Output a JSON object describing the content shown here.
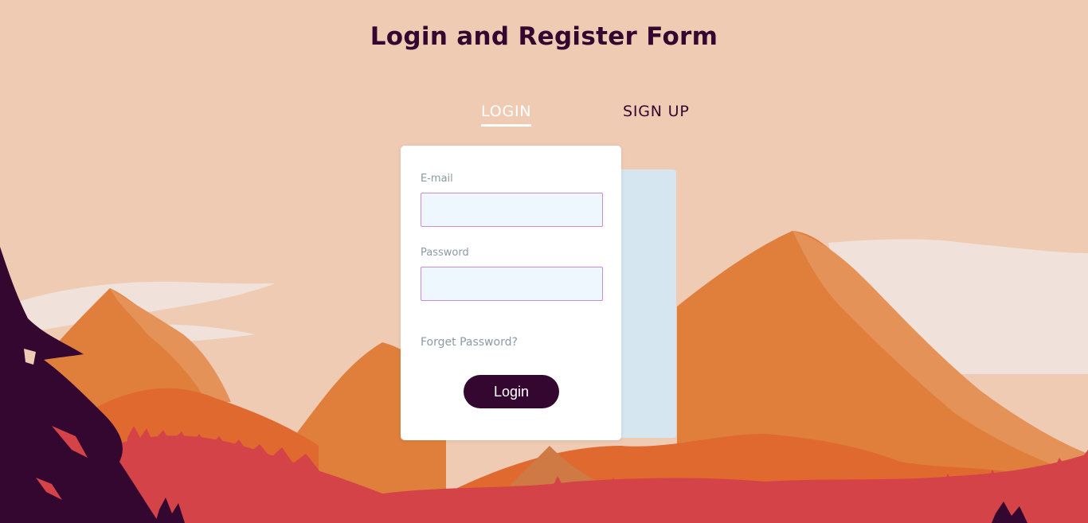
{
  "page": {
    "title": "Login and Register Form"
  },
  "tabs": {
    "login": "LOGIN",
    "signup": "SIGN UP",
    "active": "login"
  },
  "form": {
    "email_label": "E-mail",
    "email_value": "",
    "password_label": "Password",
    "password_value": "",
    "forget_link": "Forget Password?",
    "submit_label": "Login"
  },
  "colors": {
    "sky": "#efcbb4",
    "accent": "#330730",
    "input_bg": "#edf7fd",
    "input_border": "#c98bd3",
    "back_card": "#d5e6f0"
  }
}
